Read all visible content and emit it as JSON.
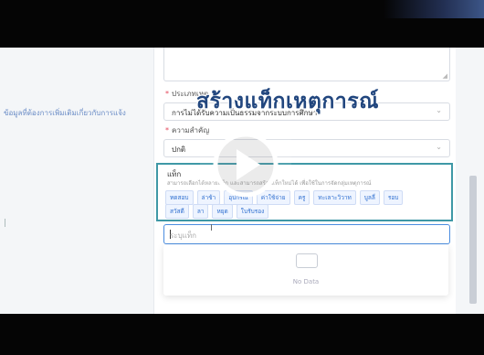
{
  "video": {
    "overlay_title": "สร้างแท็กเหตุการณ์"
  },
  "background": {
    "left_hint": "ข้อมูลที่ต้องการเพิ่มเติมเกี่ยวกับการแจ้ง",
    "left_mark": "|"
  },
  "form": {
    "resize_glyph": "◢",
    "category": {
      "label": "ประเภทเหตุ",
      "value": "การไม่ได้รับความเป็นธรรมจากระบบการศึกษา",
      "chevron": "⌄"
    },
    "priority": {
      "label": "ความสำคัญ",
      "value": "ปกติ",
      "chevron": "⌄"
    },
    "required_mark": "*",
    "tags": {
      "title": "แท็ก",
      "description": "สามารถเลือกได้หลายแท็ก และสามารถสร้างแท็กใหม่ได้ เพื่อใช้ในการจัดกลุ่มเหตุการณ์",
      "row1": [
        "ทดสอบ",
        "ล่าช้า",
        "อุปกรณ์",
        "ค่าใช้จ่าย",
        "ครู",
        "ทะเลาะวิวาท",
        "บูลลี่",
        "รอบ"
      ],
      "row2": [
        "สวัสดี",
        "ลา",
        "หยุด",
        "ใบรับรอง"
      ],
      "input_placeholder": "ระบุแท็ก",
      "ibeam": "I"
    },
    "dropdown": {
      "empty_text": "No Data"
    }
  },
  "colors": {
    "tag_border": "#3f98a6",
    "chip_text": "#2f6fd0",
    "title_fill": "#21467e"
  }
}
